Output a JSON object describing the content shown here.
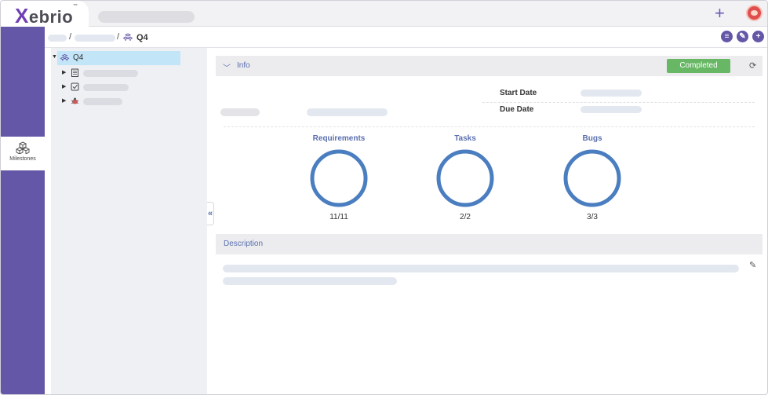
{
  "app": {
    "logo_x": "X",
    "logo_rest": "ebrio",
    "logo_tm": "™"
  },
  "topbar": {
    "add_icon": "+"
  },
  "nav": {
    "items": [
      {
        "label": "Milestones",
        "icon": "cubes-icon"
      }
    ]
  },
  "breadcrumb": {
    "separator": "/",
    "current": "Q4"
  },
  "breadcrumb_actions": {
    "add_list": "≡",
    "edit": "✎",
    "add": "+"
  },
  "tree": {
    "root_label": "Q4"
  },
  "info": {
    "title": "Info",
    "status": "Completed",
    "status_color": "#67b765",
    "start_date_label": "Start Date",
    "due_date_label": "Due Date"
  },
  "stats": [
    {
      "label": "Requirements",
      "value": "11/11",
      "fraction": 1.0
    },
    {
      "label": "Tasks",
      "value": "2/2",
      "fraction": 1.0
    },
    {
      "label": "Bugs",
      "value": "3/3",
      "fraction": 1.0
    }
  ],
  "description": {
    "title": "Description"
  },
  "colors": {
    "accent": "#6557a8",
    "ring": "#4a7ec0",
    "link": "#5a6fae"
  }
}
